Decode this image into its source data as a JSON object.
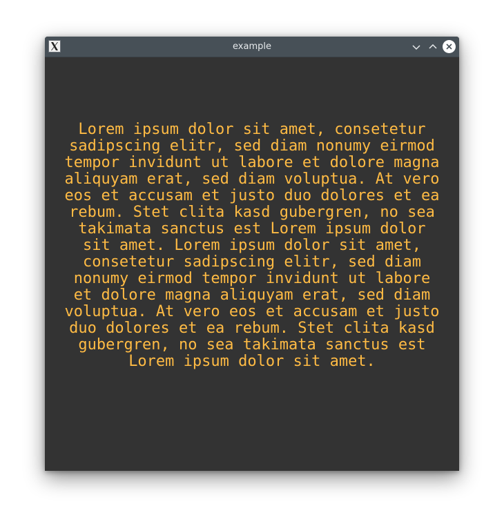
{
  "window": {
    "title": "example"
  },
  "titlebar": {
    "app_icon": "x11-icon",
    "minimize_icon": "chevron-down-icon",
    "maximize_icon": "chevron-up-icon",
    "close_icon": "close-icon"
  },
  "content": {
    "text": "Lorem ipsum dolor sit amet, consetetur sadipscing elitr, sed diam nonumy eirmod tempor invidunt ut labore et dolore magna aliquyam erat, sed diam voluptua. At vero eos et accusam et justo duo dolores et ea rebum. Stet clita kasd gubergren, no sea takimata sanctus est Lorem ipsum dolor sit amet. Lorem ipsum dolor sit amet, consetetur sadipscing elitr, sed diam nonumy eirmod tempor invidunt ut labore et dolore magna aliquyam erat, sed diam voluptua. At vero eos et accusam et justo duo dolores et ea rebum. Stet clita kasd gubergren, no sea takimata sanctus est Lorem ipsum dolor sit amet."
  },
  "colors": {
    "background": "#333333",
    "text": "#ffbb44",
    "titlebar": "#475057"
  }
}
